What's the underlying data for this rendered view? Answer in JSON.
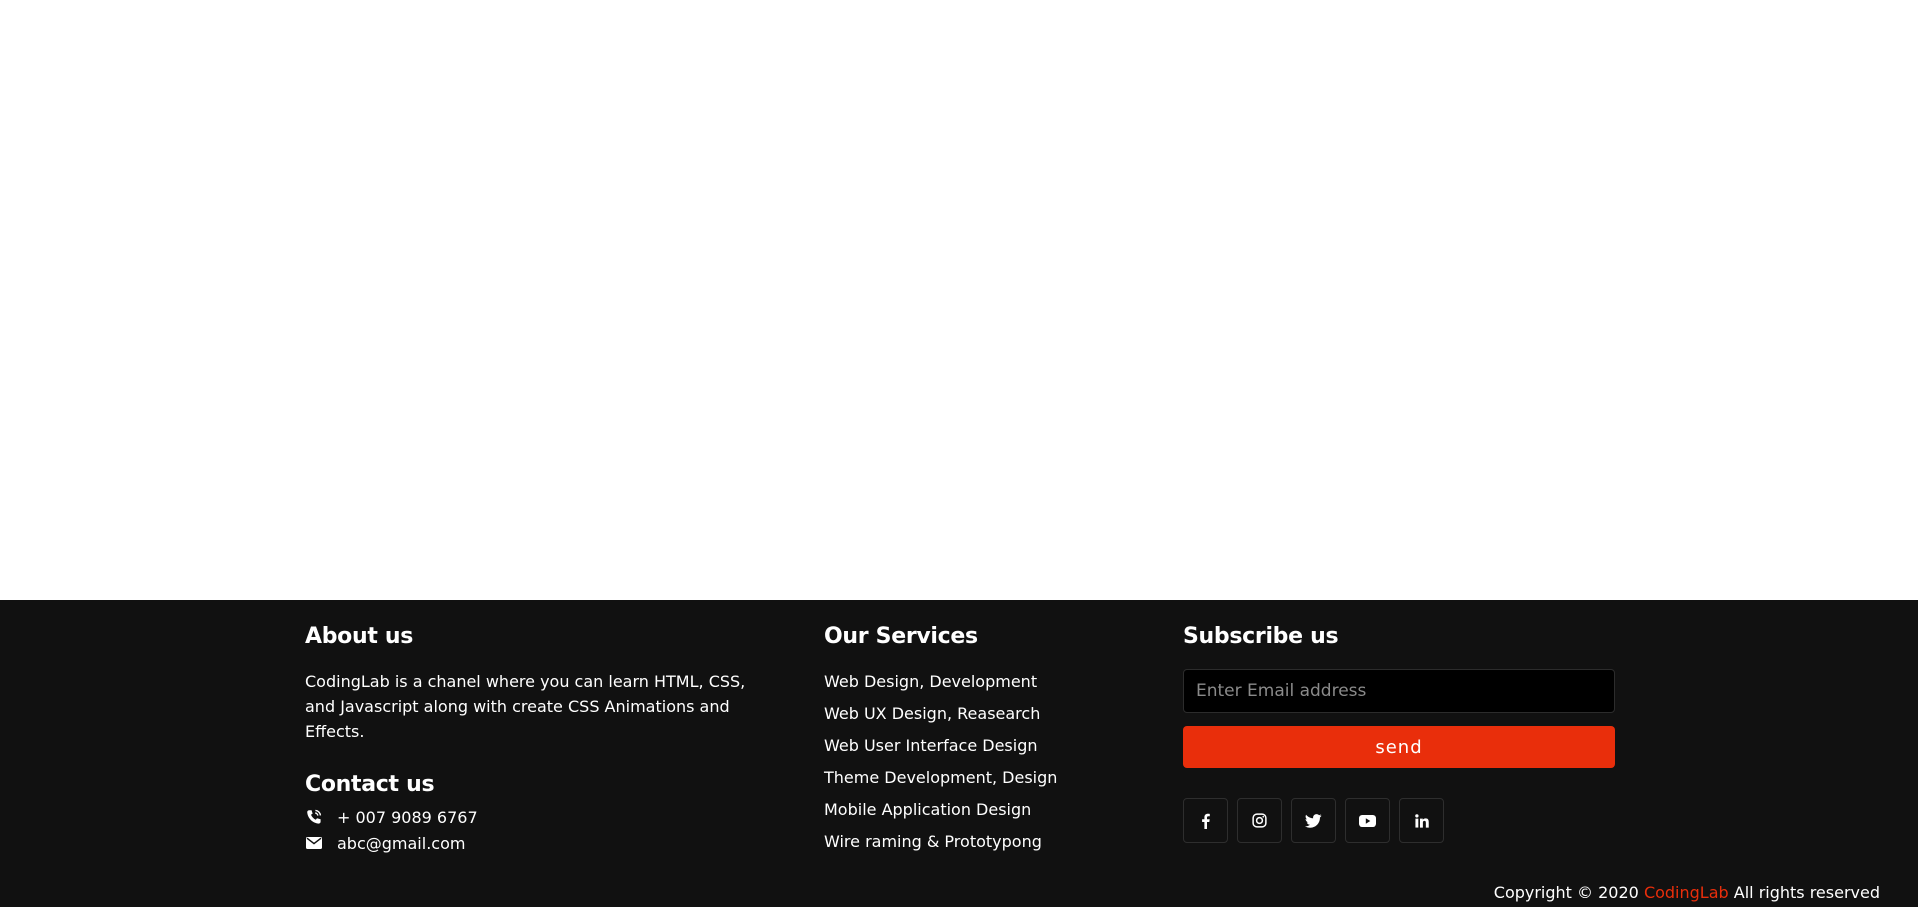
{
  "about": {
    "title": "About us",
    "text": "CodingLab is a chanel where you can learn HTML, CSS, and Javascript along with create CSS Animations and Effects."
  },
  "contact": {
    "title": "Contact us",
    "phone": "+ 007 9089 6767",
    "email": "abc@gmail.com",
    "phone_icon": "phone-icon",
    "email_icon": "envelope-icon"
  },
  "services": {
    "title": "Our Services",
    "items": [
      "Web Design, Development",
      "Web UX Design, Reasearch",
      "Web User Interface Design",
      "Theme Development, Design",
      "Mobile Application Design",
      "Wire raming & Prototypong"
    ]
  },
  "subscribe": {
    "title": "Subscribe us",
    "placeholder": "Enter Email address",
    "button_label": "send",
    "social_icons": [
      "facebook-icon",
      "instagram-icon",
      "twitter-icon",
      "youtube-icon",
      "linkedin-icon"
    ]
  },
  "copyright": {
    "prefix": "Copyright © 2020",
    "brand": "CodingLab",
    "suffix": "All rights reserved"
  },
  "colors": {
    "footer_bg": "#111111",
    "accent": "#e92e0b",
    "input_bg": "#000000",
    "text": "#ffffff"
  }
}
